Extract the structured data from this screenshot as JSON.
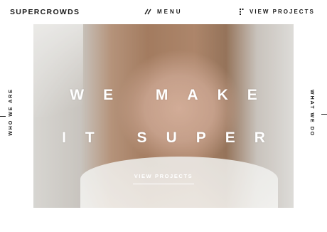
{
  "header": {
    "logo": "SUPERCROWDS",
    "menu_label": "MENU",
    "menu_icon": "hamburger-slash-icon",
    "view_projects_label": "VIEW PROJECTS",
    "view_projects_icon": "dots-grid-icon"
  },
  "side_nav": {
    "left_label": "WHO WE ARE",
    "right_label": "WHAT WE DO"
  },
  "hero": {
    "headline_line1": "WE MAKE",
    "headline_line2": "IT SUPER",
    "cta_label": "VIEW PROJECTS"
  },
  "colors": {
    "text": "#1a1a1a",
    "background": "#ffffff",
    "overlay_text": "#ffffff"
  }
}
